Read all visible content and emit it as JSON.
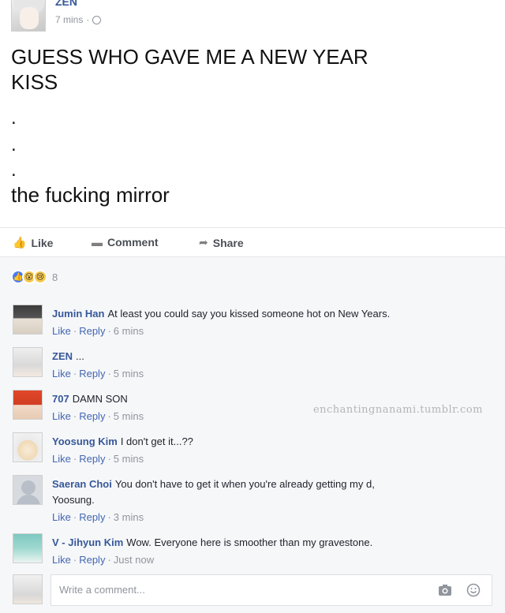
{
  "post": {
    "author": "ZEN",
    "time": "7 mins",
    "lines": [
      "GUESS WHO GAVE ME A NEW YEAR",
      "KISS"
    ],
    "dots": [
      ".",
      ".",
      "."
    ],
    "punchline": "the fucking mirror"
  },
  "actions": {
    "like": "Like",
    "comment": "Comment",
    "share": "Share"
  },
  "reactions": {
    "count": "8"
  },
  "comments": [
    {
      "name": "Jumin Han",
      "text": "At least you could say you kissed someone hot on New Years.",
      "like": "Like",
      "reply": "Reply",
      "time": "6 mins"
    },
    {
      "name": "ZEN",
      "text": "...",
      "like": "Like",
      "reply": "Reply",
      "time": "5 mins"
    },
    {
      "name": "707",
      "text": "DAMN SON",
      "like": "Like",
      "reply": "Reply",
      "time": "5 mins"
    },
    {
      "name": "Yoosung Kim",
      "text": "I don't get it...??",
      "like": "Like",
      "reply": "Reply",
      "time": "5 mins"
    },
    {
      "name": "Saeran Choi",
      "text": "You don't have to get it when you're already getting my d,",
      "text2": "Yoosung.",
      "like": "Like",
      "reply": "Reply",
      "time": "3 mins"
    },
    {
      "name": "V - Jihyun Kim",
      "text": "Wow. Everyone here is smoother than my gravestone.",
      "like": "Like",
      "reply": "Reply",
      "time": "Just now"
    }
  ],
  "watermark": "enchantingnanami.tumblr.com",
  "composer": {
    "placeholder": "Write a comment..."
  }
}
